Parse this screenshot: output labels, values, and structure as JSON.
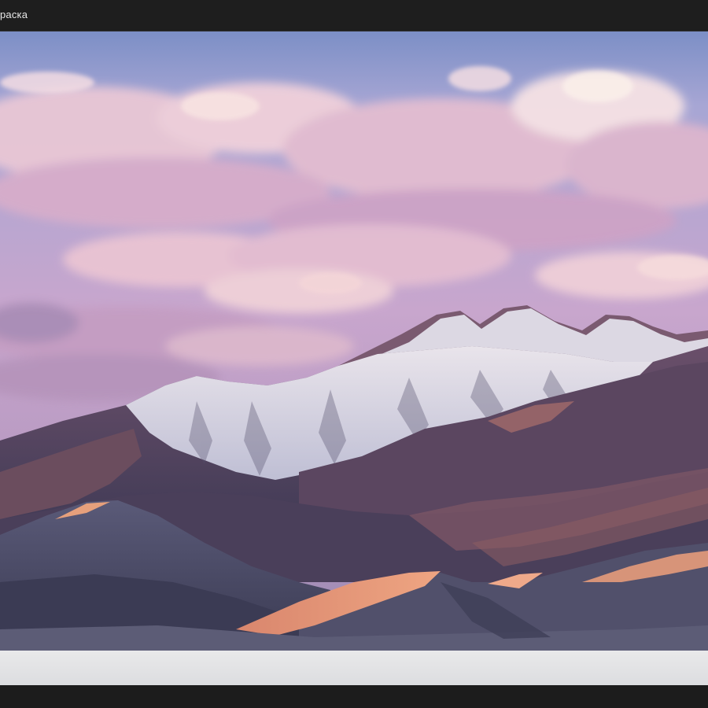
{
  "window": {
    "title": "раска"
  },
  "image": {
    "subject": "mountain-landscape-photo",
    "palette": {
      "sky_top": "#7f93c8",
      "sky_mid": "#c9a7cf",
      "cloud": "#e8c3d2",
      "snow": "#eef0f7",
      "ridge": "#4a3f5d",
      "dune_light": "#e39a7a",
      "dune_dark": "#4b4a63"
    }
  }
}
